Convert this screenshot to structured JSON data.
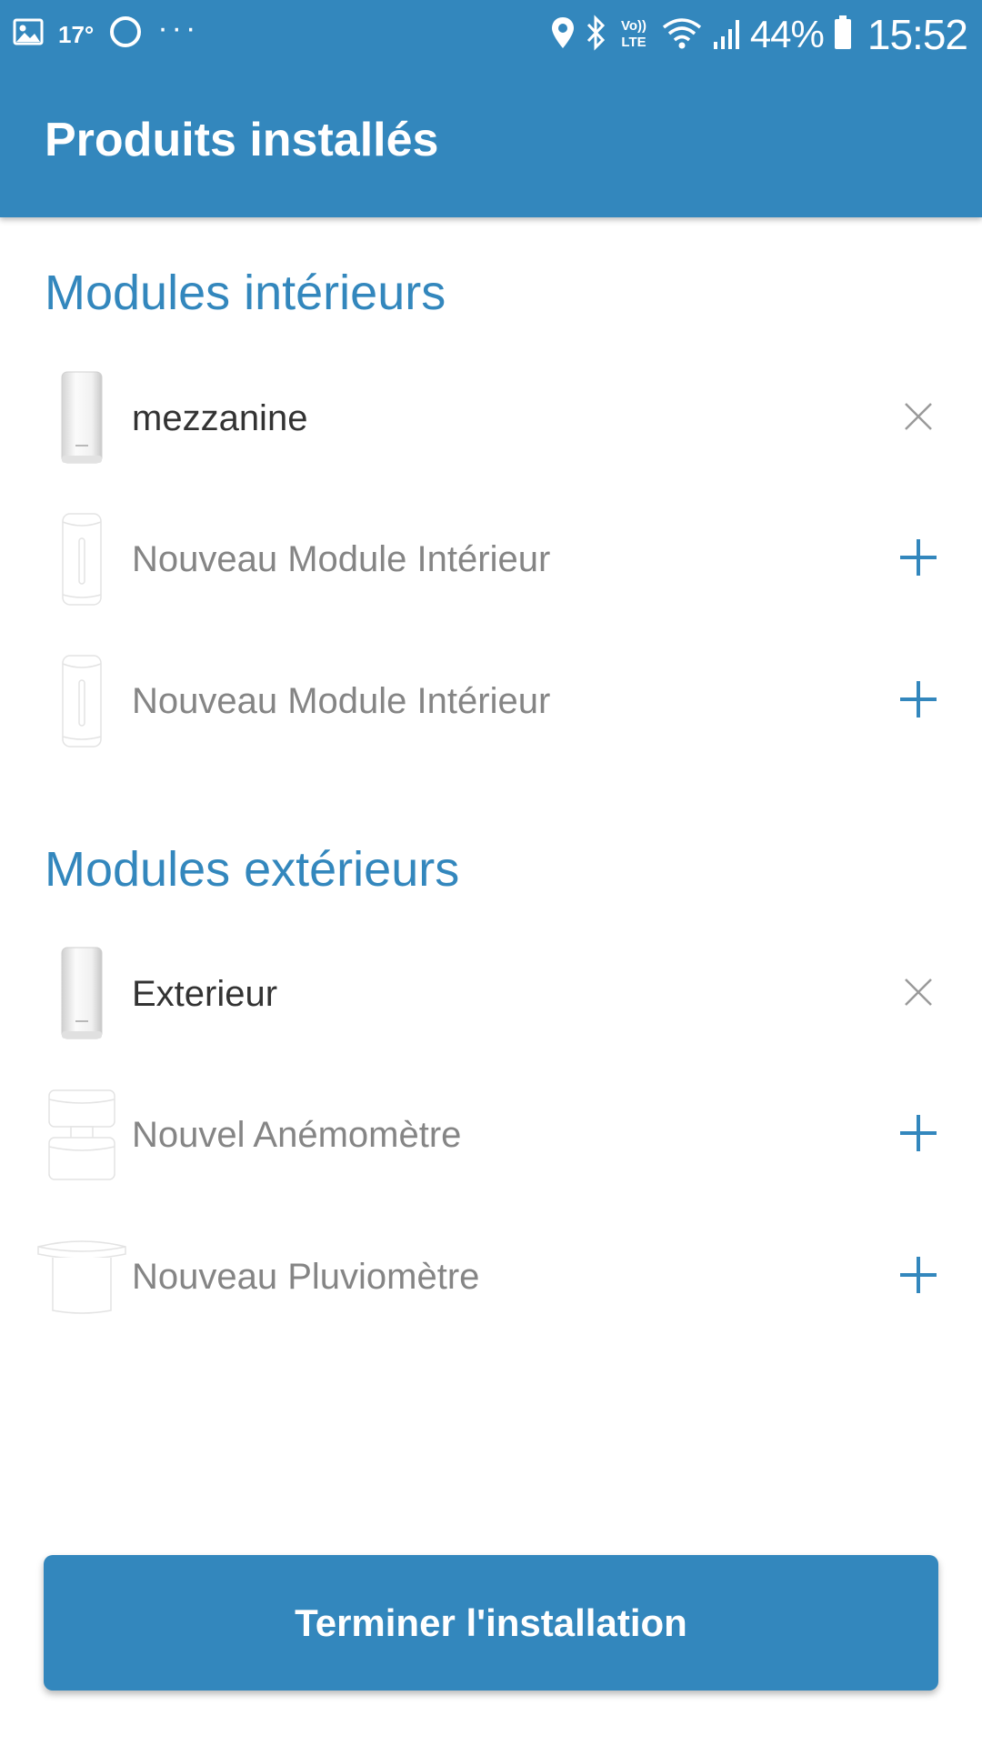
{
  "status_bar": {
    "temperature": "17°",
    "overflow": "···",
    "network": "VoLTE",
    "battery_percent": "44%",
    "time": "15:52",
    "icons": [
      "gallery-icon",
      "circle-app-icon",
      "location-icon",
      "bluetooth-icon",
      "volte-icon",
      "wifi-icon",
      "signal-icon",
      "battery-icon"
    ]
  },
  "header": {
    "title": "Produits installés"
  },
  "indoor": {
    "title": "Modules intérieurs",
    "items": [
      {
        "label": "mezzanine",
        "installed": true,
        "icon": "indoor-module-icon",
        "action": "close-icon"
      },
      {
        "label": "Nouveau Module Intérieur",
        "installed": false,
        "icon": "indoor-module-icon",
        "action": "plus-icon"
      },
      {
        "label": "Nouveau Module Intérieur",
        "installed": false,
        "icon": "indoor-module-icon",
        "action": "plus-icon"
      }
    ]
  },
  "outdoor": {
    "title": "Modules extérieurs",
    "items": [
      {
        "label": "Exterieur",
        "installed": true,
        "icon": "outdoor-module-icon",
        "action": "close-icon"
      },
      {
        "label": "Nouvel Anémomètre",
        "installed": false,
        "icon": "anemometer-icon",
        "action": "plus-icon"
      },
      {
        "label": "Nouveau Pluviomètre",
        "installed": false,
        "icon": "rain-gauge-icon",
        "action": "plus-icon"
      }
    ]
  },
  "footer": {
    "finish_label": "Terminer l'installation"
  },
  "colors": {
    "primary": "#3387bd",
    "text_installed": "#333333",
    "text_placeholder": "#858585",
    "close_icon": "#9a9a9a"
  }
}
